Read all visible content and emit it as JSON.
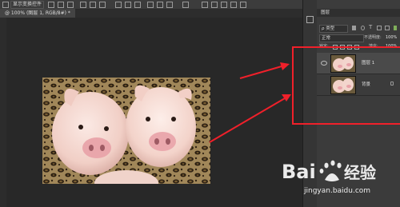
{
  "options_bar": {
    "tool_label": "显示变换控件"
  },
  "document": {
    "tab_title": "@ 100% (图层 1, RGB/8#) *"
  },
  "layers_panel": {
    "tab_label": "图层",
    "kind_label": "ρ 类型",
    "blend_mode": "正常",
    "opacity_label": "不透明度:",
    "opacity_value": "100%",
    "lock_label": "锁定:",
    "fill_label": "填充:",
    "fill_value": "100%",
    "layers": [
      {
        "name": "图层 1",
        "visible": true
      },
      {
        "name": "背景",
        "visible": false
      }
    ]
  },
  "annotation": {
    "color": "#f0202a"
  },
  "watermark": {
    "logo_text": "Bai经验",
    "url": "jingyan.baidu.com"
  }
}
